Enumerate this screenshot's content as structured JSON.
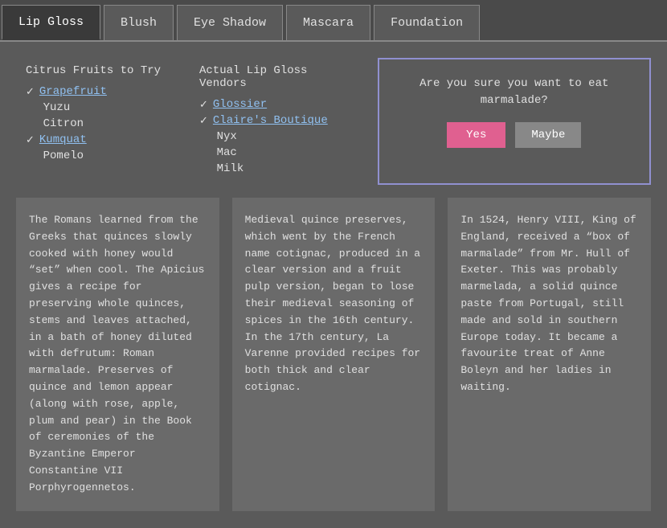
{
  "tabs": [
    {
      "label": "Lip Gloss",
      "active": true
    },
    {
      "label": "Blush",
      "active": false
    },
    {
      "label": "Eye Shadow",
      "active": false
    },
    {
      "label": "Mascara",
      "active": false
    },
    {
      "label": "Foundation",
      "active": false
    }
  ],
  "list1": {
    "title": "Citrus Fruits to Try",
    "items": [
      {
        "text": "Grapefruit",
        "checked": true,
        "link": true
      },
      {
        "text": "Yuzu",
        "checked": false,
        "link": false
      },
      {
        "text": "Citron",
        "checked": false,
        "link": false
      },
      {
        "text": "Kumquat",
        "checked": true,
        "link": true
      },
      {
        "text": "Pomelo",
        "checked": false,
        "link": false
      }
    ]
  },
  "list2": {
    "title": "Actual Lip Gloss Vendors",
    "items": [
      {
        "text": "Glossier",
        "checked": true,
        "link": true
      },
      {
        "text": "Claire's Boutique",
        "checked": true,
        "link": true
      },
      {
        "text": "Nyx",
        "checked": false,
        "link": false
      },
      {
        "text": "Mac",
        "checked": false,
        "link": false
      },
      {
        "text": "Milk",
        "checked": false,
        "link": false
      }
    ]
  },
  "dialog": {
    "text": "Are you sure you want to eat marmalade?",
    "yes_label": "Yes",
    "maybe_label": "Maybe"
  },
  "cards": [
    {
      "text": "The Romans learned from the Greeks that quinces slowly cooked with honey would “set” when cool. The Apicius gives a recipe for preserving whole quinces, stems and leaves attached, in a bath of honey diluted with defrutum: Roman marmalade. Preserves of quince and lemon appear (along with rose, apple, plum and pear) in the Book of ceremonies of the Byzantine Emperor Constantine VII Porphyrogennetos."
    },
    {
      "text": "Medieval quince preserves, which went by the French name cotignac, produced in a clear version and a fruit pulp version, began to lose their medieval seasoning of spices in the 16th century. In the 17th century, La Varenne provided recipes for both thick and clear cotignac."
    },
    {
      "text": "In 1524, Henry VIII, King of England, received a “box of marmalade” from Mr. Hull of Exeter. This was probably marmelada, a solid quince paste from Portugal, still made and sold in southern Europe today. It became a favourite treat of Anne Boleyn and her ladies in waiting."
    }
  ]
}
